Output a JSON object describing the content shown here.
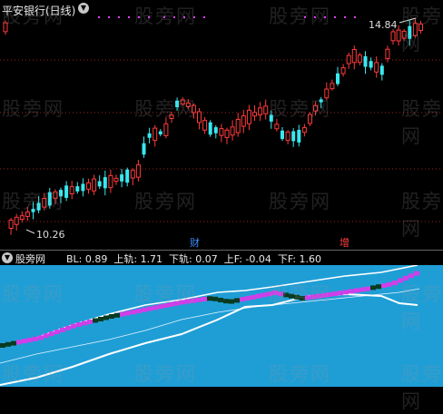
{
  "main_panel": {
    "title": "平安银行(日线)",
    "high_label": "14.84",
    "low_label": "10.26",
    "markers": [
      {
        "text": "财",
        "color": "#3a8cff"
      },
      {
        "text": "增",
        "color": "#ff4040"
      }
    ]
  },
  "indicator": {
    "name": "股旁网",
    "params_text": "BL: 0.89  上轨: 1.71  下轨: 0.07  上F: -0.04  下F: 1.60"
  },
  "watermark": "股旁网",
  "colors": {
    "up": "#ff3a3a",
    "down": "#38e8f0",
    "grid": "#b02020",
    "band": "#cf3fe8",
    "band_alt": "#0a3a20"
  }
}
